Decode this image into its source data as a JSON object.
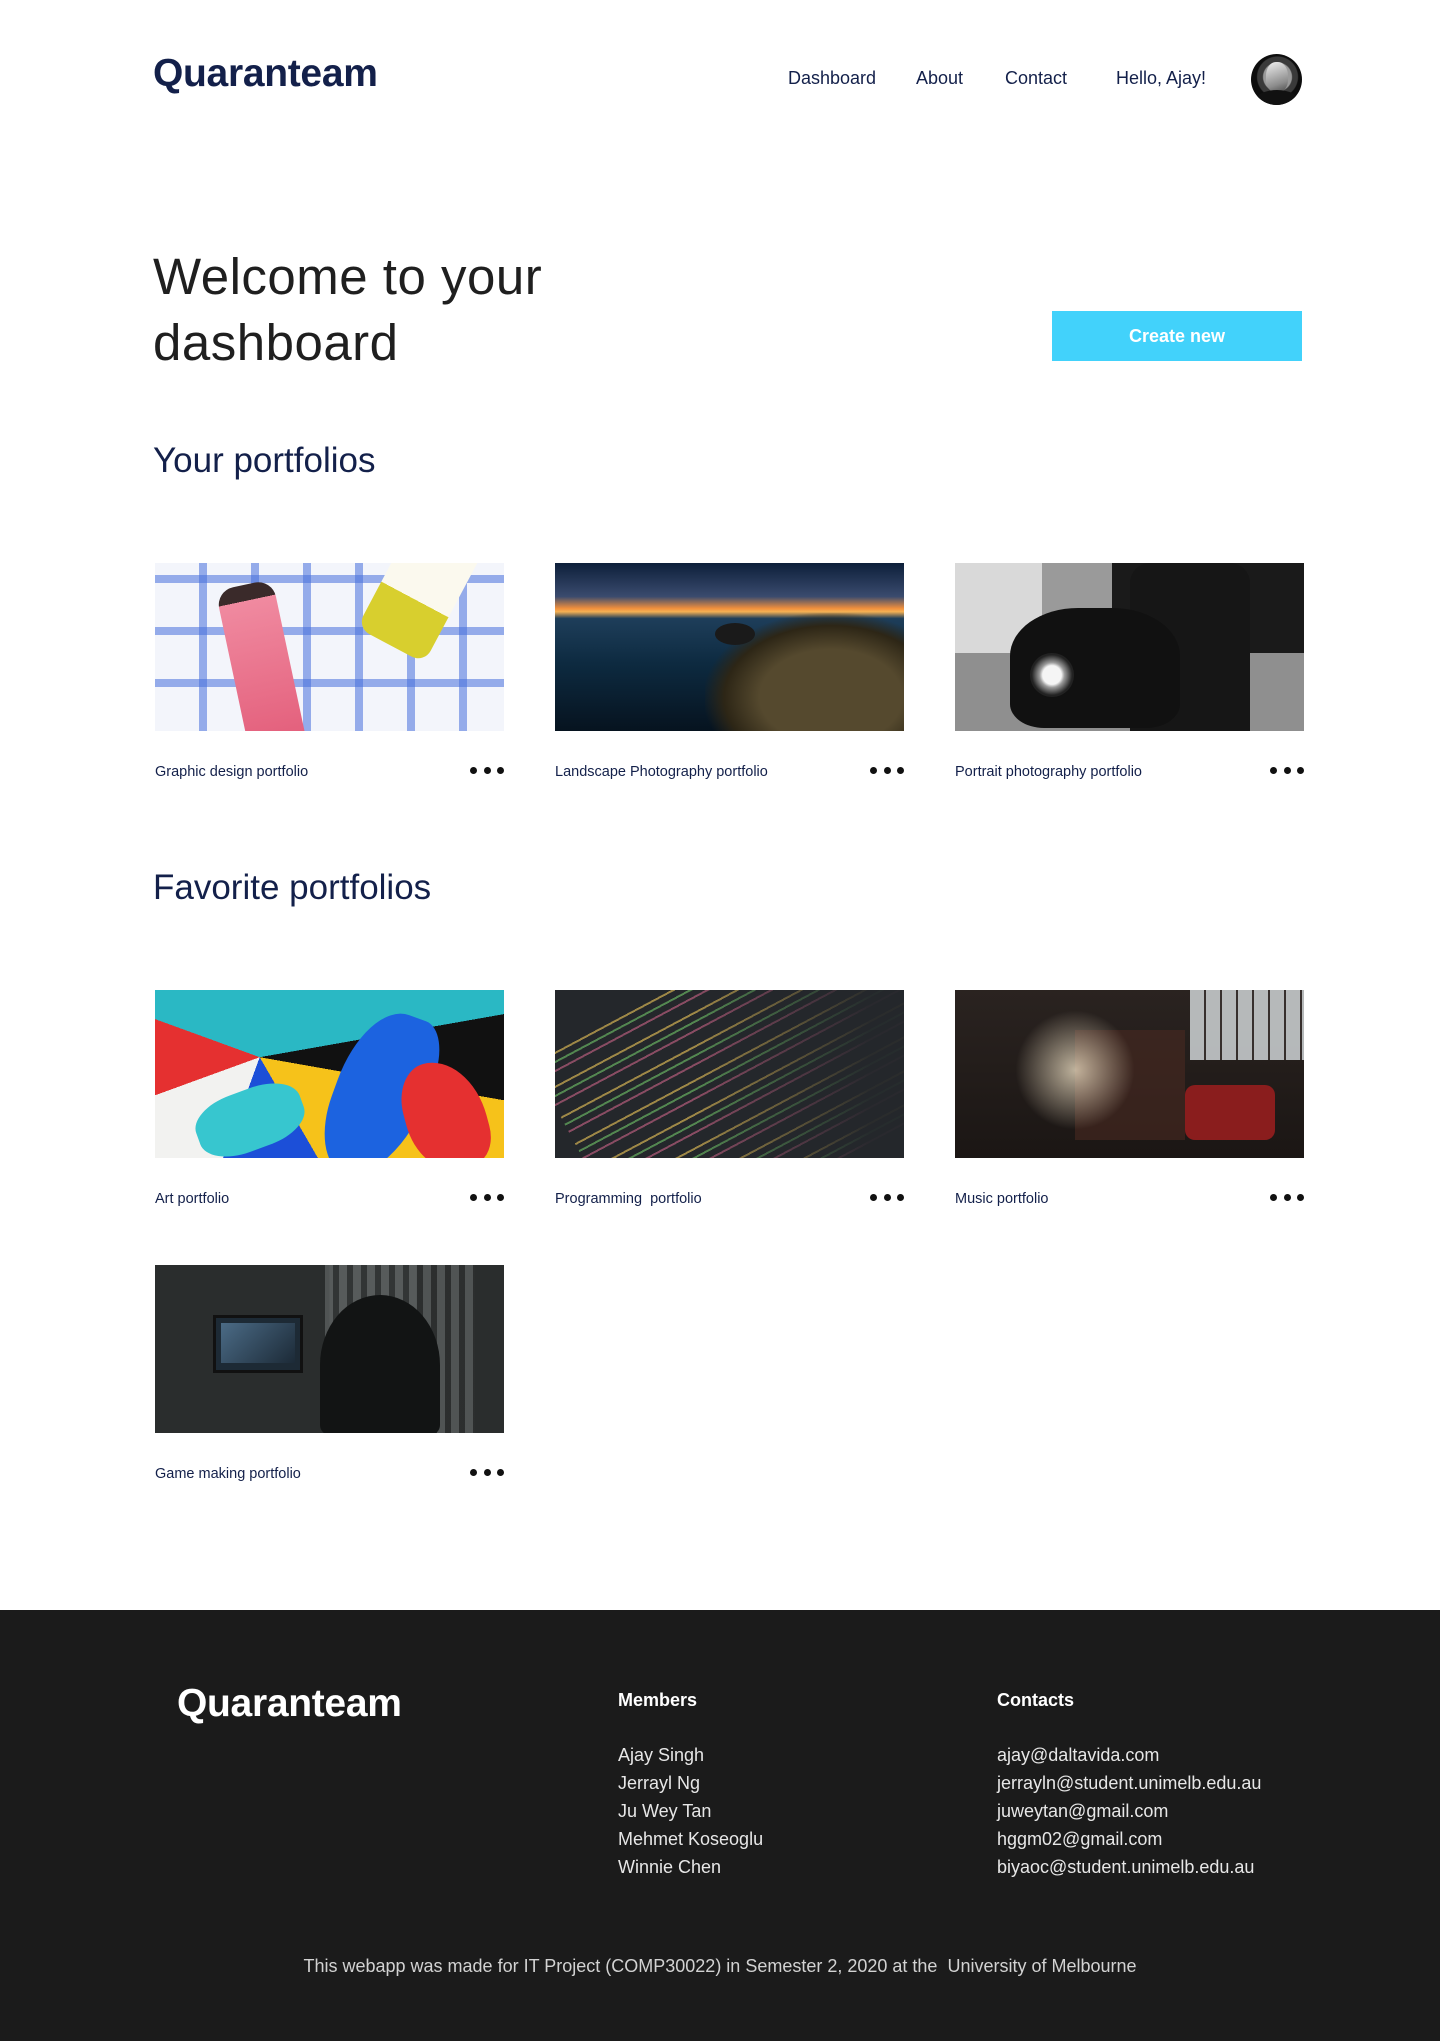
{
  "header": {
    "logo": "Quaranteam",
    "nav": [
      "Dashboard",
      "About",
      "Contact",
      "Hello, Ajay!"
    ]
  },
  "hero": {
    "title": "Welcome to your dashboard",
    "create_button": "Create new"
  },
  "sections": {
    "your_portfolios": "Your portfolios",
    "favorite_portfolios": "Favorite portfolios"
  },
  "your_portfolios": [
    {
      "name": "Graphic design portfolio"
    },
    {
      "name": "Landscape Photography portfolio"
    },
    {
      "name": "Portrait photography portfolio"
    }
  ],
  "favorite_portfolios": [
    {
      "name": "Art portfolio"
    },
    {
      "name": "Programming  portfolio"
    },
    {
      "name": "Music portfolio"
    },
    {
      "name": "Game making portfolio"
    }
  ],
  "footer": {
    "logo": "Quaranteam",
    "members_title": "Members",
    "members": [
      "Ajay Singh",
      "Jerrayl Ng",
      "Ju Wey Tan",
      "Mehmet Koseoglu",
      "Winnie Chen"
    ],
    "contacts_title": "Contacts",
    "contacts": [
      "ajay@daltavida.com",
      "jerrayln@student.unimelb.edu.au",
      "juweytan@gmail.com",
      "hggm02@gmail.com",
      "biyaoc@student.unimelb.edu.au"
    ],
    "credit": "This webapp was made for IT Project (COMP30022) in Semester 2, 2020 at the  University of Melbourne"
  },
  "colors": {
    "brand_navy": "#13204a",
    "accent_cyan": "#42d2fb",
    "footer_bg": "#1b1b1b"
  },
  "icons": {
    "card_menu": "more-horizontal-icon",
    "avatar": "user-avatar"
  }
}
